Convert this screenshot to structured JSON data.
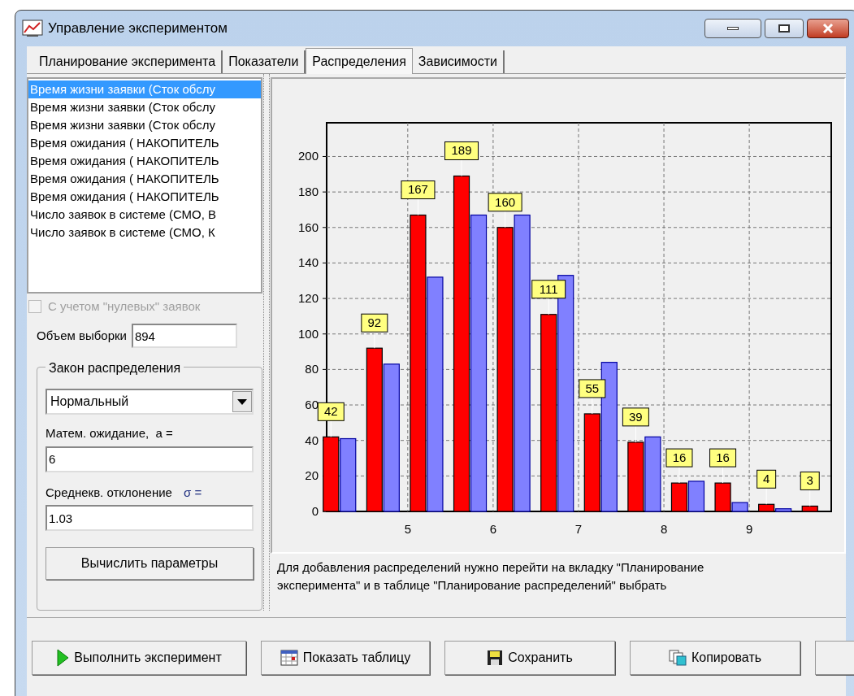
{
  "window": {
    "title": "Управление экспериментом"
  },
  "tabs": [
    {
      "label": "Планирование эксперимента",
      "selected": false
    },
    {
      "label": "Показатели",
      "selected": false
    },
    {
      "label": "Распределения",
      "selected": true
    },
    {
      "label": "Зависимости",
      "selected": false
    }
  ],
  "distributions_list": [
    {
      "label": "Время жизни заявки (Сток обслу",
      "selected": true
    },
    {
      "label": "Время жизни заявки (Сток обслу",
      "selected": false
    },
    {
      "label": "Время жизни заявки (Сток обслу",
      "selected": false
    },
    {
      "label": "Время ожидания ( НАКОПИТЕЛЬ",
      "selected": false
    },
    {
      "label": "Время ожидания ( НАКОПИТЕЛЬ",
      "selected": false
    },
    {
      "label": "Время ожидания ( НАКОПИТЕЛЬ",
      "selected": false
    },
    {
      "label": "Время ожидания ( НАКОПИТЕЛЬ",
      "selected": false
    },
    {
      "label": "Число заявок в системе (СМО, В",
      "selected": false
    },
    {
      "label": "Число заявок в системе (СМО, К",
      "selected": false
    }
  ],
  "zero_requests_checkbox": {
    "label": "С учетом \"нулевых\" заявок",
    "checked": false,
    "disabled": true
  },
  "sample_size": {
    "label": "Объем выборки",
    "value": "894"
  },
  "distribution_law": {
    "title": "Закон распределения",
    "type": "Нормальный",
    "mean_label": "Матем. ожидание,  a =",
    "mean_value": "6",
    "sd_label": "Среднекв. отклонение",
    "sd_symbol": "σ =",
    "sd_value": "1.03",
    "compute_button": "Вычислить параметры"
  },
  "chart_data": {
    "type": "bar",
    "x": [
      4.2,
      4.71,
      5.22,
      5.73,
      6.24,
      6.75,
      7.26,
      7.77,
      8.28,
      8.79,
      9.3,
      9.81
    ],
    "grid": true,
    "series": [
      {
        "color": "#ff0000",
        "values": [
          42,
          92,
          167,
          189,
          160,
          111,
          55,
          39,
          16,
          16,
          4,
          3
        ]
      },
      {
        "color": "#8080ff",
        "values": [
          41,
          83,
          132,
          167,
          167,
          133,
          84,
          42,
          17,
          5,
          1.5,
          0
        ]
      }
    ],
    "xlim": [
      4.05,
      9.96
    ],
    "ylim": [
      0,
      219
    ],
    "xticks": [
      5,
      6,
      7,
      8,
      9
    ],
    "yticks": [
      0,
      20,
      40,
      60,
      80,
      100,
      120,
      140,
      160,
      180,
      200
    ],
    "value_labels": [
      "42",
      "92",
      "167",
      "189",
      "160",
      "111",
      "55",
      "39",
      "16",
      "16",
      "4",
      "3"
    ]
  },
  "hint": "Для добавления распределений нужно перейти на вкладку \"Планирование эксперимента\" и в таблице \"Планирование распределений\" выбрать",
  "buttons": [
    {
      "kind": "run",
      "label": "Выполнить эксперимент"
    },
    {
      "kind": "table",
      "label": "Показать таблицу"
    },
    {
      "kind": "save",
      "label": "Сохранить"
    },
    {
      "kind": "copy",
      "label": "Копировать"
    },
    {
      "kind": "blank"
    }
  ]
}
